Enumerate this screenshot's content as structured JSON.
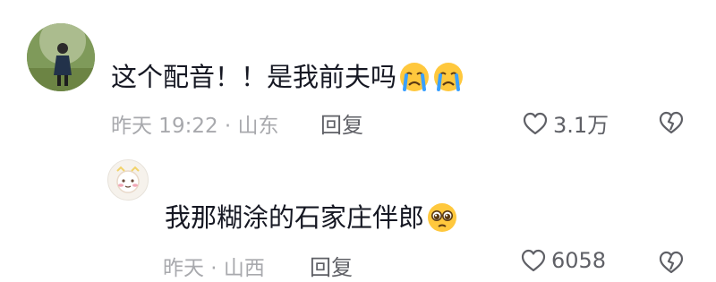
{
  "comments": [
    {
      "text": "这个配音！！是我前夫吗",
      "emoji": [
        "crying-face",
        "crying-face"
      ],
      "time_location": "昨天 19:22 · 山东",
      "reply_label": "回复",
      "likes": "3.1万"
    },
    {
      "text": "我那糊涂的石家庄伴郎",
      "emoji": [
        "pleading-face"
      ],
      "time_location": "昨天 · 山西",
      "reply_label": "回复",
      "likes": "6058"
    }
  ],
  "colors": {
    "text_primary": "#161823",
    "text_meta": "#a8a9ad",
    "text_action": "#5f6066",
    "emoji_yellow": "#ffc83d",
    "emoji_tear": "#3aa0ff"
  }
}
